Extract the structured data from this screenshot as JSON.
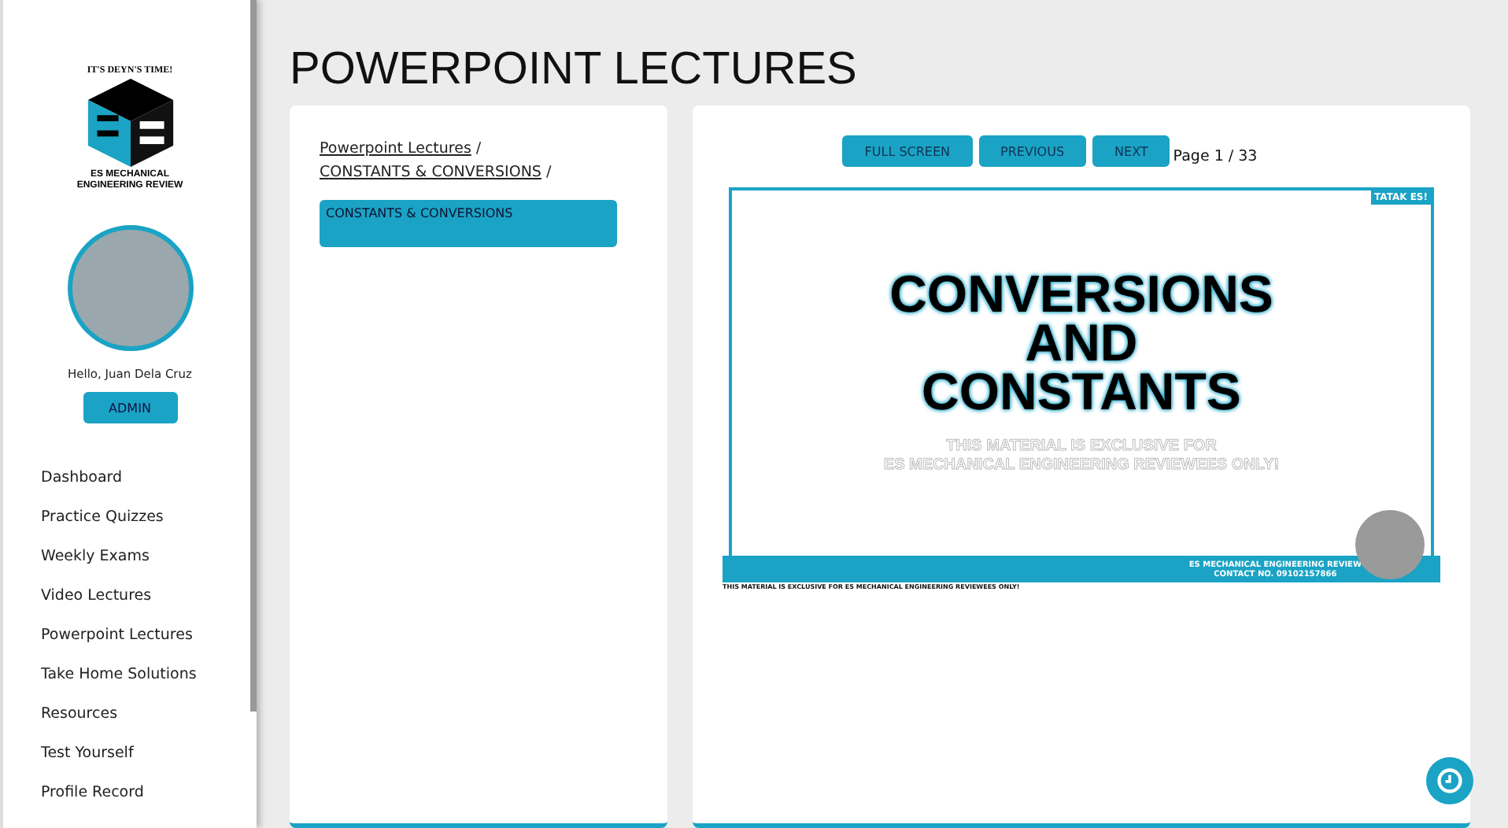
{
  "sidebar": {
    "logo": {
      "top_text": "IT'S DEYN'S TIME!",
      "bottom_text": "ES MECHANICAL ENGINEERING REVIEW"
    },
    "greeting": "Hello, Juan Dela Cruz",
    "role_button": "ADMIN",
    "items": [
      {
        "label": "Dashboard"
      },
      {
        "label": "Practice Quizzes"
      },
      {
        "label": "Weekly Exams"
      },
      {
        "label": "Video Lectures"
      },
      {
        "label": "Powerpoint Lectures"
      },
      {
        "label": "Take Home Solutions"
      },
      {
        "label": "Resources"
      },
      {
        "label": "Test Yourself"
      },
      {
        "label": "Profile Record"
      }
    ]
  },
  "page_title": "POWERPOINT LECTURES",
  "breadcrumb": {
    "links": [
      "Powerpoint Lectures",
      "CONSTANTS & CONVERSIONS"
    ],
    "separator": "/"
  },
  "lectures": [
    {
      "label": "CONSTANTS & CONVERSIONS",
      "selected": true
    }
  ],
  "viewer": {
    "buttons": [
      "FULL SCREEN",
      "PREVIOUS",
      "NEXT"
    ],
    "page_indicator": "Page 1 / 33",
    "slide": {
      "tag": "TATAK ES!",
      "title_lines": [
        "CONVERSIONS",
        "AND",
        "CONSTANTS"
      ],
      "notice_lines": [
        "THIS MATERIAL IS EXCLUSIVE FOR",
        "ES MECHANICAL ENGINEERING REVIEWEES ONLY!"
      ],
      "footer_title": "ES MECHANICAL ENGINEERING REVIEW",
      "footer_contact": "CONTACT NO. 09102157866",
      "bottom_note": "THIS MATERIAL IS EXCLUSIVE FOR ES MECHANICAL ENGINEERING REVIEWEES ONLY!"
    }
  }
}
